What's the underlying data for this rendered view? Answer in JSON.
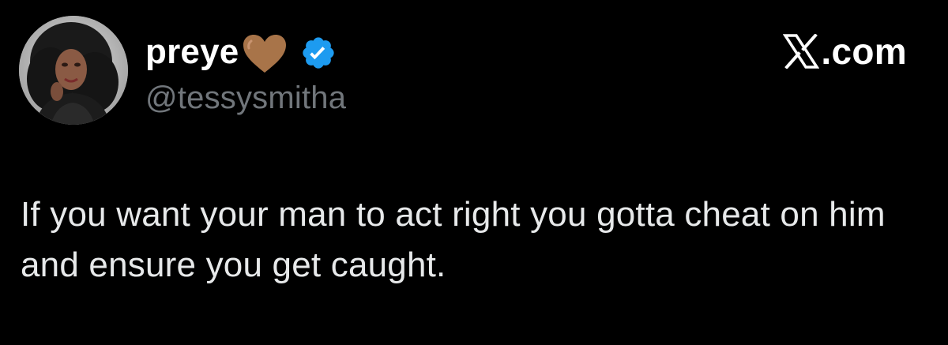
{
  "tweet": {
    "display_name": "preye",
    "name_emoji": "brown-heart-icon",
    "verified_badge": "verified-badge-icon",
    "handle": "@tessysmitha",
    "brand": "X.com",
    "brand_icon": "x-logo-icon",
    "text": "If you want your man to act right you gotta cheat on him and ensure you get caught."
  },
  "colors": {
    "background": "#000000",
    "name": "#ffffff",
    "handle": "#71767b",
    "text": "#e7e9ea",
    "verified": "#1d9bf0",
    "heart": "#a87449"
  }
}
